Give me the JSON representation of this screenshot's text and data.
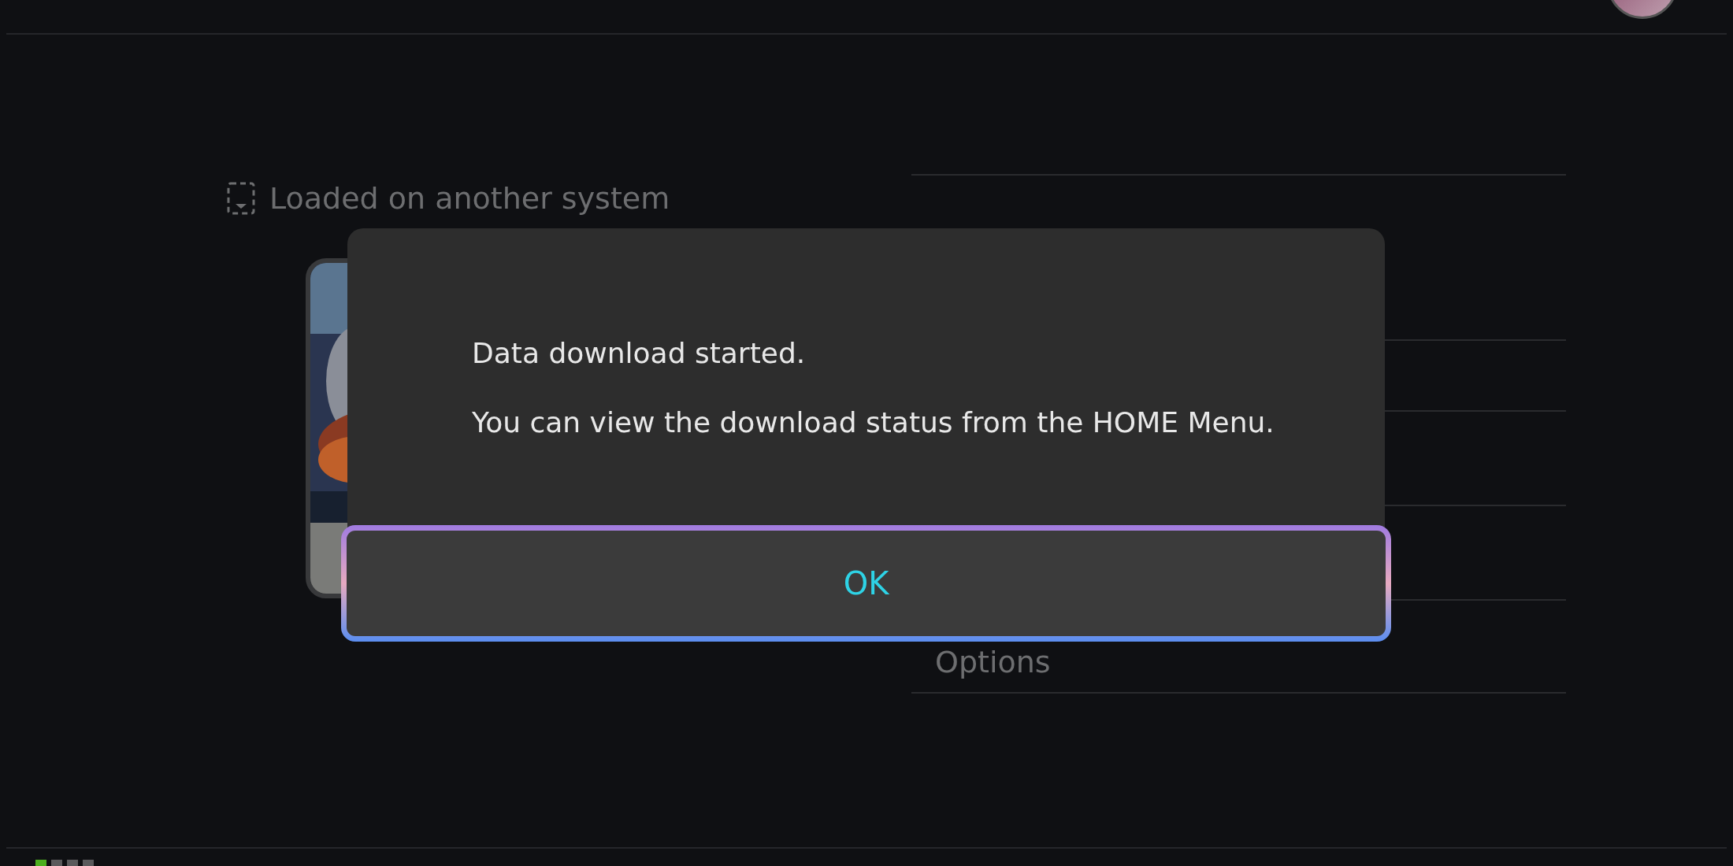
{
  "section": {
    "title": "Loaded on another system"
  },
  "menu": {
    "visible_item": "Options"
  },
  "dialog": {
    "messages": [
      "Data download started.",
      "You can view the download status from the HOME Menu."
    ],
    "button": "OK"
  },
  "pages": [
    {
      "selected": true
    },
    {
      "selected": false
    },
    {
      "selected": false
    },
    {
      "selected": false
    }
  ]
}
